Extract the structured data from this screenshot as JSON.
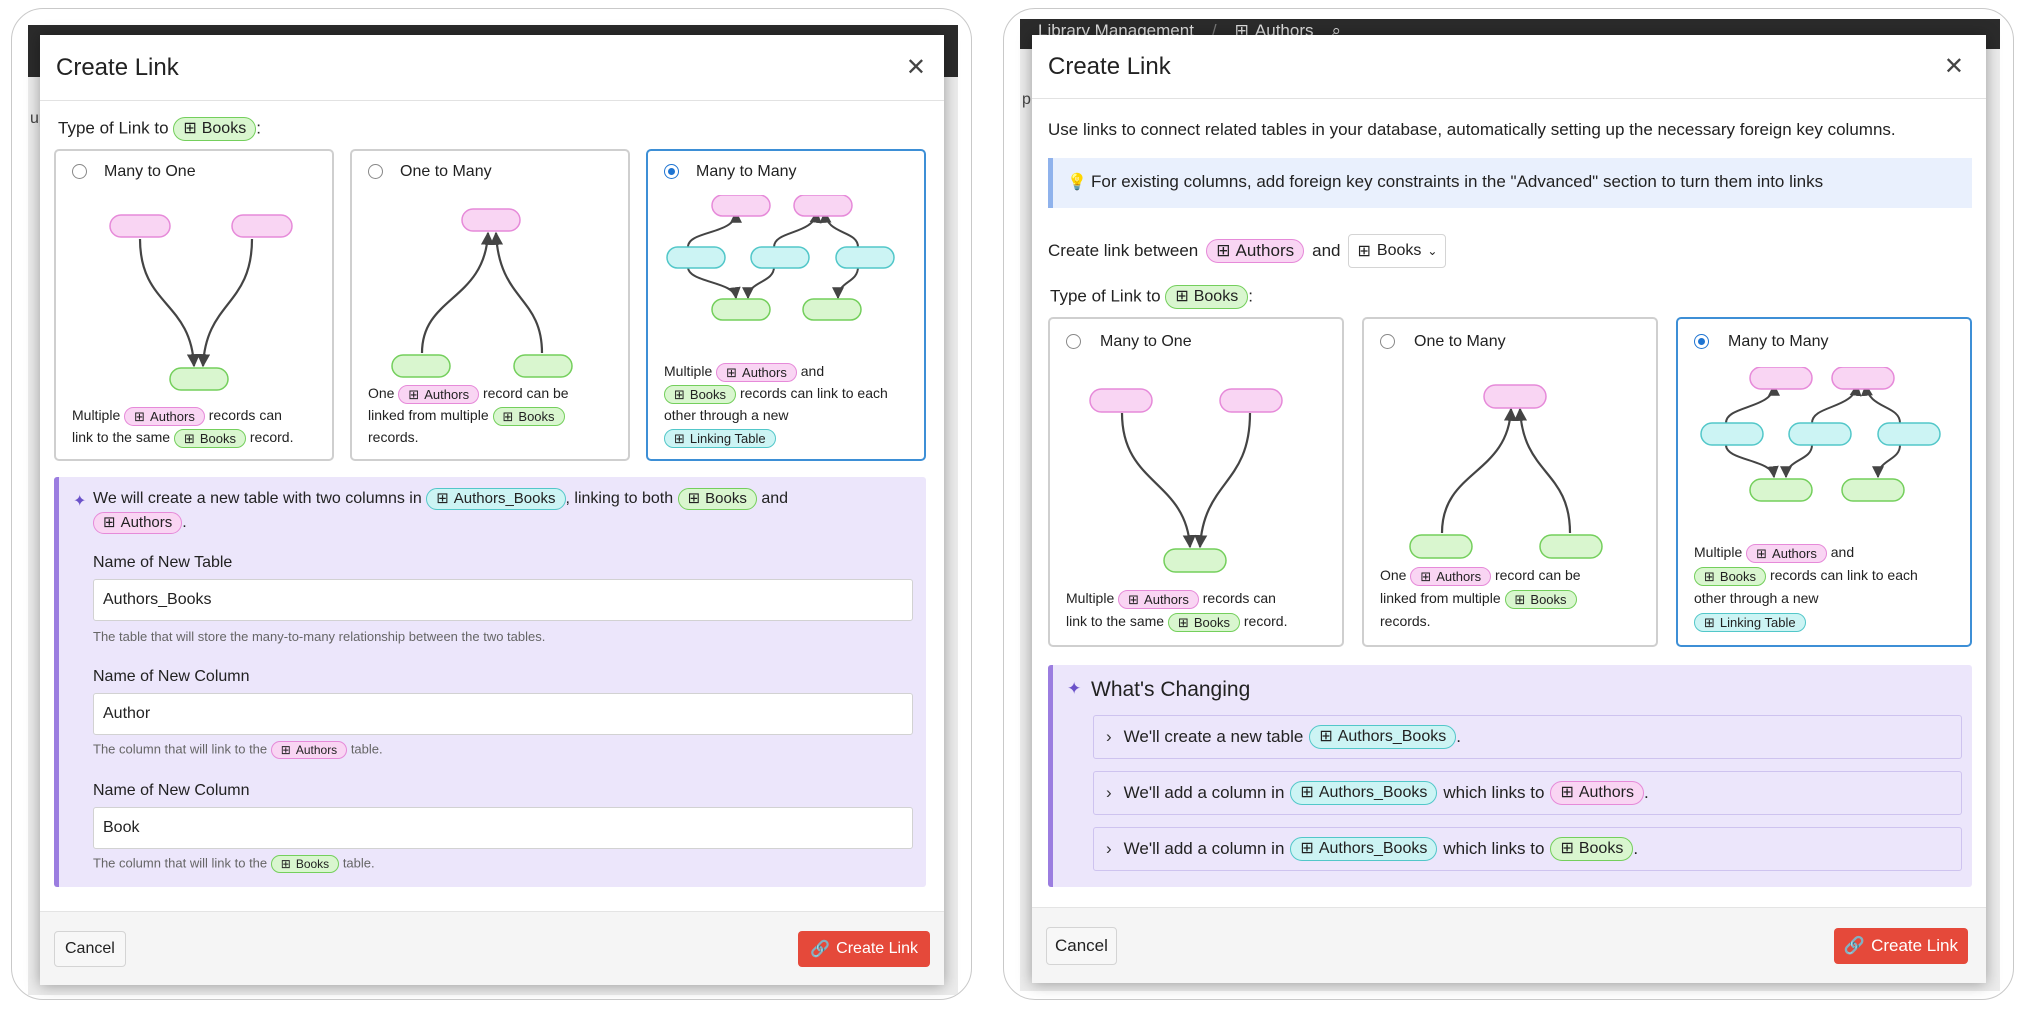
{
  "colors": {
    "accent": "#1e74d2",
    "create": "#e5493a",
    "pink": "#f9d5f3",
    "green": "#d9f6cf",
    "cyan": "#ccf4f4",
    "purple": "#ece6fb"
  },
  "left": {
    "bg_label": "up",
    "title": "Create Link",
    "type_prefix": "Type of Link to",
    "type_table": "Books",
    "type_suffix": ":",
    "cards": [
      {
        "label": "Many to One",
        "d1": "Multiple",
        "d1_pill": "Authors",
        "d1_after": "records can",
        "d2a": "link to the same",
        "d2_pill": "Books",
        "d2b": "record."
      },
      {
        "label": "One to Many",
        "d1": "One",
        "d1_pill": "Authors",
        "d1_after": "record can be",
        "d2a": "linked from multiple",
        "d2_pill": "Books",
        "d3": "records."
      },
      {
        "label": "Many to Many",
        "d1": "Multiple",
        "d1_pill": "Authors",
        "d1_after": "and",
        "d2_pill": "Books",
        "d2b": "records can link to each",
        "d3": "other through a new",
        "d4_pill": "Linking Table"
      }
    ],
    "info_a": "We will create a new table with two columns in",
    "info_table": "Authors_Books",
    "info_b": ", linking to both",
    "info_books": "Books",
    "info_c": "and",
    "info_authors": "Authors",
    "info_d": ".",
    "fields": [
      {
        "label": "Name of New Table",
        "value": "Authors_Books",
        "hint": "The table that will store the many-to-many relationship between the two tables."
      },
      {
        "label": "Name of New Column",
        "value": "Author",
        "hint_a": "The column that will link to the",
        "hint_pill": "Authors",
        "hint_b": "table."
      },
      {
        "label": "Name of New Column",
        "value": "Book",
        "hint_a": "The column that will link to the",
        "hint_pill": "Books",
        "hint_b": "table."
      }
    ],
    "cancel": "Cancel",
    "create": "Create Link"
  },
  "right": {
    "bg_title": "Library Management",
    "bg_table": "Authors",
    "bg_side": "p",
    "title": "Create Link",
    "intro": "Use links to connect related tables in your database, automatically setting up the necessary foreign key columns.",
    "tip": "For existing columns, add foreign key constraints in the \"Advanced\" section to turn them into links",
    "between_label": "Create link between",
    "between_table": "Authors",
    "between_and": "and",
    "between_select": "Books",
    "type_prefix": "Type of Link to",
    "type_table": "Books",
    "type_suffix": ":",
    "cards": [
      {
        "label": "Many to One",
        "d1": "Multiple",
        "d1_pill": "Authors",
        "d1_after": "records can",
        "d2a": "link to the same",
        "d2_pill": "Books",
        "d2b": "record."
      },
      {
        "label": "One to Many",
        "d1": "One",
        "d1_pill": "Authors",
        "d1_after": "record can be",
        "d2a": "linked from multiple",
        "d2_pill": "Books",
        "d3": "records."
      },
      {
        "label": "Many to Many",
        "d1": "Multiple",
        "d1_pill": "Authors",
        "d1_after": "and",
        "d2_pill": "Books",
        "d2b": "records can link to each",
        "d3": "other through a new",
        "d4_pill": "Linking Table"
      }
    ],
    "changing_title": "What's Changing",
    "changes": [
      {
        "a": "We'll create a new table",
        "t1": "Authors_Books",
        "b": "."
      },
      {
        "a": "We'll add a column in",
        "t1": "Authors_Books",
        "b": "which links to",
        "t2": "Authors",
        "c": "."
      },
      {
        "a": "We'll add a column in",
        "t1": "Authors_Books",
        "b": "which links to",
        "t2": "Books",
        "c": "."
      }
    ],
    "cancel": "Cancel",
    "create": "Create Link"
  }
}
